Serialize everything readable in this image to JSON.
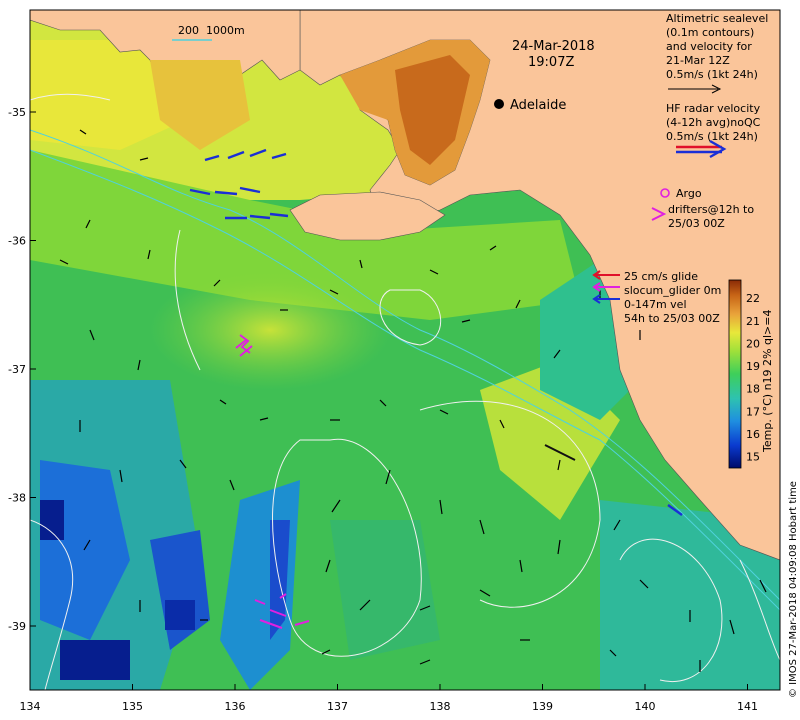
{
  "map": {
    "date": "24-Mar-2018",
    "time": "19:07Z",
    "city": "Adelaide",
    "depth_contour_labels": [
      "200",
      "1000m"
    ],
    "x_ticks": [
      "134",
      "135",
      "136",
      "137",
      "138",
      "139",
      "140",
      "141"
    ],
    "y_ticks": [
      "-35",
      "-36",
      "-37",
      "-38",
      "-39"
    ]
  },
  "legend": {
    "altimetry": [
      "Altimetric sealevel",
      "(0.1m contours)",
      "and velocity for",
      "21-Mar 12Z",
      "0.5m/s (1kt 24h)"
    ],
    "hf_radar": [
      "HF radar velocity",
      "(4-12h avg)noQC",
      "0.5m/s (1kt 24h)"
    ],
    "argo": [
      "Argo",
      "drifters@12h to",
      "25/03 00Z"
    ],
    "glider": [
      "25 cm/s glide",
      "slocum_glider 0m",
      "0-147m vel",
      "54h to 25/03 00Z"
    ]
  },
  "colorbar": {
    "label": "Temp. (°C) n19 2% ql>=4",
    "ticks": [
      "22",
      "21",
      "20",
      "19",
      "18",
      "17",
      "16",
      "15"
    ],
    "min": 14.5,
    "max": 22.8
  },
  "credit": "© IMOS 27-Mar-2018 04:09:08 Hobart time",
  "colors": {
    "land": "#fac59a",
    "hf_radar_blue": "#1a2fd6",
    "hf_radar_red": "#e0102a",
    "argo_magenta": "#e020e0",
    "contour": "#f0f0f0",
    "depth_contour": "#4fd2dc"
  }
}
